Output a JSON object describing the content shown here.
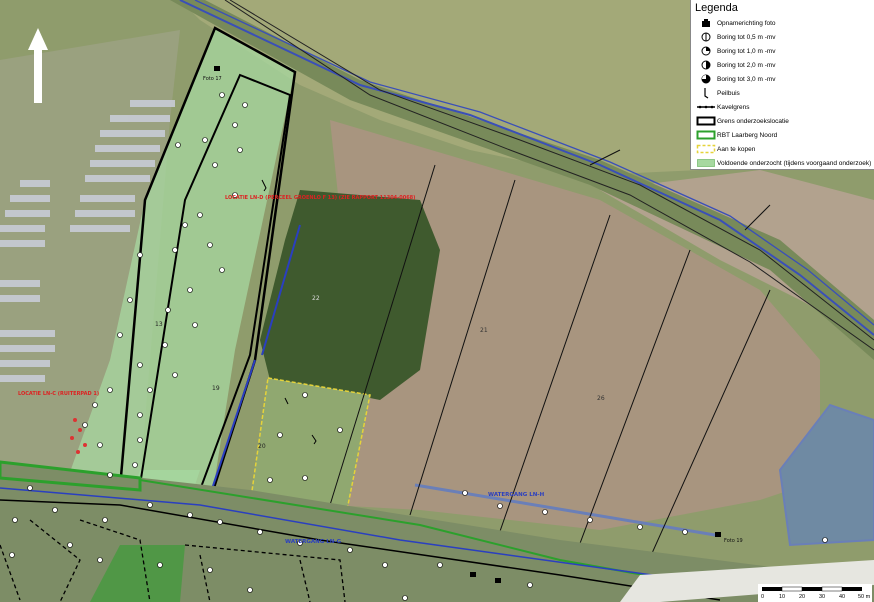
{
  "legend": {
    "title": "Legenda",
    "items": [
      {
        "label": "Opnamerichting foto",
        "icon": "camera-icon"
      },
      {
        "label": "Boring tot 0,5 m -mv",
        "icon": "boring-05-icon"
      },
      {
        "label": "Boring tot 1,0 m -mv",
        "icon": "boring-10-icon"
      },
      {
        "label": "Boring tot 2,0 m -mv",
        "icon": "boring-20-icon"
      },
      {
        "label": "Boring tot 3,0 m -mv",
        "icon": "boring-30-icon"
      },
      {
        "label": "Peilbuis",
        "icon": "peilbuis-icon"
      },
      {
        "label": "Kavelgrens",
        "icon": "kavelgrens-line"
      },
      {
        "label": "Grens onderzoekslocatie",
        "icon": "grens-box",
        "color": "#000000"
      },
      {
        "label": "RBT Laarberg Noord",
        "icon": "rbt-box",
        "color": "#2ca02c"
      },
      {
        "label": "Aan te kopen",
        "icon": "aankoop-box",
        "color": "#e5d33a"
      },
      {
        "label": "Voldoende onderzocht (tijdens voorgaand onderzoek)",
        "icon": "voldoende-box",
        "color": "#a7d8a0"
      }
    ]
  },
  "map_labels": {
    "locatie_d": "LOCATIE LN-D (PERCEEL GROENLO F 13) (ZIE RAPPORT 11304-0068)",
    "locatie_c": "LOCATIE LN-C (RUITERPAD 1)",
    "watergang_h": "WATERGANG LN-H",
    "watergang_g": "WATERGANG LN-G",
    "parcel_21": "21",
    "parcel_22": "22",
    "parcel_26": "26",
    "parcel_19": "19",
    "parcel_20": "20",
    "parcel_13": "13",
    "foto_17": "Foto 17",
    "foto_19": "Foto 19"
  },
  "scalebar": {
    "ticks": [
      "0",
      "10",
      "20",
      "30",
      "40",
      "50 m"
    ]
  },
  "colors": {
    "field_brown": "#a99784",
    "grass": "#8ea86b",
    "trees": "#3f5a2e",
    "water": "#6fa0c8",
    "investigated": "#a7d8a0",
    "rbt": "#2ca02c",
    "aankoop": "#e5d33a",
    "canal": "#3a4fb8"
  },
  "north_arrow": {
    "icon": "north-arrow-icon"
  }
}
